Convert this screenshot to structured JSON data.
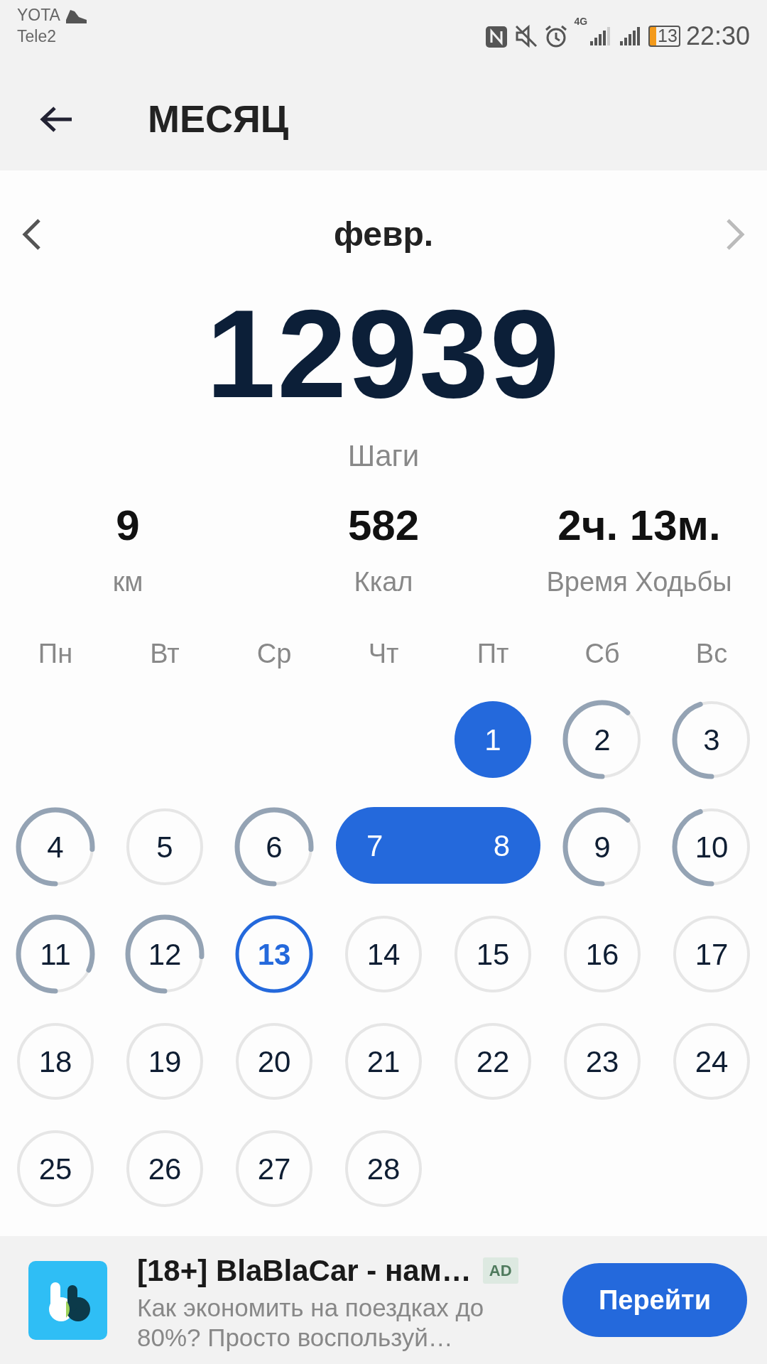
{
  "status_bar": {
    "carrier_1": "YOTA",
    "carrier_2": "Tele2",
    "network": "4G",
    "battery": "13",
    "time": "22:30"
  },
  "app_bar": {
    "title": "МЕСЯЦ"
  },
  "month_nav": {
    "label": "февр.",
    "prev_disabled": false,
    "next_disabled": true
  },
  "summary": {
    "steps": "12939",
    "steps_label": "Шаги"
  },
  "stats": [
    {
      "value": "9",
      "label": "км"
    },
    {
      "value": "582",
      "label": "Ккал"
    },
    {
      "value": "2ч. 13м.",
      "label": "Время Ходьбы"
    }
  ],
  "weekdays": [
    "Пн",
    "Вт",
    "Ср",
    "Чт",
    "Пт",
    "Сб",
    "Вс"
  ],
  "weeks": [
    [
      {
        "kind": "blank"
      },
      {
        "kind": "blank"
      },
      {
        "kind": "blank"
      },
      {
        "kind": "blank"
      },
      {
        "day": "1",
        "kind": "goal"
      },
      {
        "day": "2",
        "kind": "over-half"
      },
      {
        "day": "3",
        "kind": "under-half"
      }
    ],
    [
      {
        "day": "4",
        "kind": "three-quarters"
      },
      {
        "day": "5",
        "kind": "empty"
      },
      {
        "day": "6",
        "kind": "three-quarters"
      },
      {
        "day": "7",
        "kind": "goal"
      },
      {
        "day": "8",
        "kind": "goal"
      },
      {
        "day": "9",
        "kind": "over-half"
      },
      {
        "day": "10",
        "kind": "under-half"
      }
    ],
    [
      {
        "day": "11",
        "kind": "most"
      },
      {
        "day": "12",
        "kind": "three-quarters"
      },
      {
        "day": "13",
        "kind": "today"
      },
      {
        "day": "14",
        "kind": "empty"
      },
      {
        "day": "15",
        "kind": "empty"
      },
      {
        "day": "16",
        "kind": "empty"
      },
      {
        "day": "17",
        "kind": "empty"
      }
    ],
    [
      {
        "day": "18",
        "kind": "empty"
      },
      {
        "day": "19",
        "kind": "empty"
      },
      {
        "day": "20",
        "kind": "empty"
      },
      {
        "day": "21",
        "kind": "empty"
      },
      {
        "day": "22",
        "kind": "empty"
      },
      {
        "day": "23",
        "kind": "empty"
      },
      {
        "day": "24",
        "kind": "empty"
      }
    ],
    [
      {
        "day": "25",
        "kind": "empty"
      },
      {
        "day": "26",
        "kind": "empty"
      },
      {
        "day": "27",
        "kind": "empty"
      },
      {
        "day": "28",
        "kind": "empty"
      },
      {
        "kind": "blank"
      },
      {
        "kind": "blank"
      },
      {
        "kind": "blank"
      }
    ]
  ],
  "ad": {
    "title": "[18+] BlaBlaCar - нам…",
    "badge": "AD",
    "text": "Как экономить на поездках до 80%? Просто воспользуй…",
    "button": "Перейти"
  }
}
